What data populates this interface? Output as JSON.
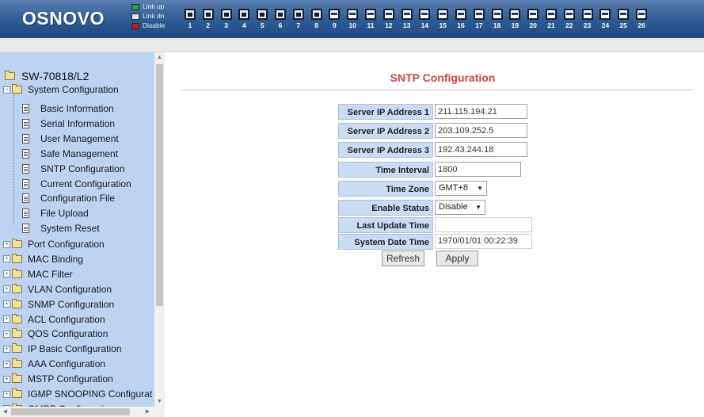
{
  "brand": "OSNOVO",
  "legend": [
    {
      "label": "Link up",
      "state": "up"
    },
    {
      "label": "Link dn",
      "state": "dn"
    },
    {
      "label": "Disable",
      "state": "dis"
    }
  ],
  "ports": [
    {
      "n": "1",
      "state": "up"
    },
    {
      "n": "2",
      "state": "up"
    },
    {
      "n": "3",
      "state": "up"
    },
    {
      "n": "4",
      "state": "up"
    },
    {
      "n": "5",
      "state": "up"
    },
    {
      "n": "6",
      "state": "up"
    },
    {
      "n": "7",
      "state": "up"
    },
    {
      "n": "8",
      "state": "up"
    },
    {
      "n": "9",
      "state": "dn"
    },
    {
      "n": "10",
      "state": "dn"
    },
    {
      "n": "11",
      "state": "dn"
    },
    {
      "n": "12",
      "state": "dn"
    },
    {
      "n": "13",
      "state": "dn"
    },
    {
      "n": "14",
      "state": "dn"
    },
    {
      "n": "15",
      "state": "dn"
    },
    {
      "n": "16",
      "state": "dn"
    },
    {
      "n": "17",
      "state": "dn"
    },
    {
      "n": "18",
      "state": "dn"
    },
    {
      "n": "19",
      "state": "dn"
    },
    {
      "n": "20",
      "state": "dn"
    },
    {
      "n": "21",
      "state": "dn"
    },
    {
      "n": "22",
      "state": "dn"
    },
    {
      "n": "23",
      "state": "dn"
    },
    {
      "n": "24",
      "state": "dn"
    },
    {
      "n": "25",
      "state": "dn"
    },
    {
      "n": "26",
      "state": "dn"
    }
  ],
  "tree": {
    "root": "SW-70818/L2",
    "system_group": "System Configuration",
    "system_items": [
      "Basic Information",
      "Serial Information",
      "User Management",
      "Safe Management",
      "SNTP Configuration",
      "Current Configuration",
      "Configuration File",
      "File Upload",
      "System Reset"
    ],
    "groups": [
      "Port Configuration",
      "MAC Binding",
      "MAC Filter",
      "VLAN Configuration",
      "SNMP Configuration",
      "ACL Configuration",
      "QOS Configuration",
      "IP Basic Configuration",
      "AAA Configuration",
      "MSTP Configuration",
      "IGMP SNOOPING Configurat",
      "GMRP Configuration"
    ]
  },
  "page": {
    "title": "SNTP Configuration",
    "fields": {
      "server1": {
        "label": "Server IP Address 1",
        "value": "211.115.194.21"
      },
      "server2": {
        "label": "Server IP Address 2",
        "value": "203.109.252.5"
      },
      "server3": {
        "label": "Server IP Address 3",
        "value": "192.43.244.18"
      },
      "interval": {
        "label": "Time Interval (second)",
        "value": "1800"
      },
      "timezone": {
        "label": "Time Zone",
        "value": "GMT+8"
      },
      "enable": {
        "label": "Enable Status",
        "value": "Disable"
      },
      "last_update": {
        "label": "Last Update Time",
        "value": ""
      },
      "system_time": {
        "label": "System Date Time",
        "value": "1970/01/01 00:22:39"
      }
    },
    "refresh_label": "Refresh",
    "apply_label": "Apply"
  }
}
